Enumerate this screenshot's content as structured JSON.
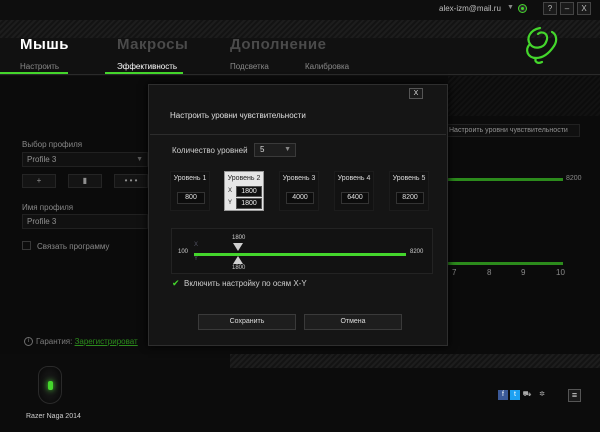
{
  "titlebar": {
    "email": "alex-izm@mail.ru",
    "help": "?",
    "minimize": "–",
    "close": "X"
  },
  "tabs": {
    "main": [
      "Мышь",
      "Макросы",
      "Дополнение"
    ],
    "sub": [
      "Настроить",
      "Эффективность",
      "Подсветка",
      "Калибровка"
    ]
  },
  "left": {
    "profile_label": "Выбор профиля",
    "profile_value": "Profile 3",
    "add": "+",
    "delete": "▮",
    "more": "• • •",
    "name_label": "Имя профиля",
    "name_value": "Profile 3",
    "link_program": "Связать программу",
    "warranty_label": "Гарантия:",
    "warranty_link": "Зарегистрироват"
  },
  "right": {
    "tooltip": "Настроить уровни чувствительности",
    "max_value": "8200",
    "ticks": [
      "7",
      "8",
      "9",
      "10"
    ]
  },
  "dialog": {
    "close": "X",
    "title": "Настроить уровни чувствительности",
    "levels_label": "Количество уровней",
    "levels_count": "5",
    "levels": [
      {
        "title": "Уровень 1",
        "value": "800"
      },
      {
        "title": "Уровень 2",
        "x": "1800",
        "y": "1800"
      },
      {
        "title": "Уровень 3",
        "value": "4000"
      },
      {
        "title": "Уровень 4",
        "value": "6400"
      },
      {
        "title": "Уровень 5",
        "value": "8200"
      }
    ],
    "slider": {
      "min": "100",
      "max": "8200",
      "x_label": "X",
      "y_label": "Y",
      "x_value": "1800",
      "y_value": "1800"
    },
    "xy_label": "Включить настройку по осям X-Y",
    "save": "Сохранить",
    "cancel": "Отмена"
  },
  "bottom": {
    "device": "Razer Naga 2014"
  },
  "colors": {
    "accent": "#44d62c",
    "facebook": "#3b5998",
    "twitter": "#1da1f2"
  }
}
